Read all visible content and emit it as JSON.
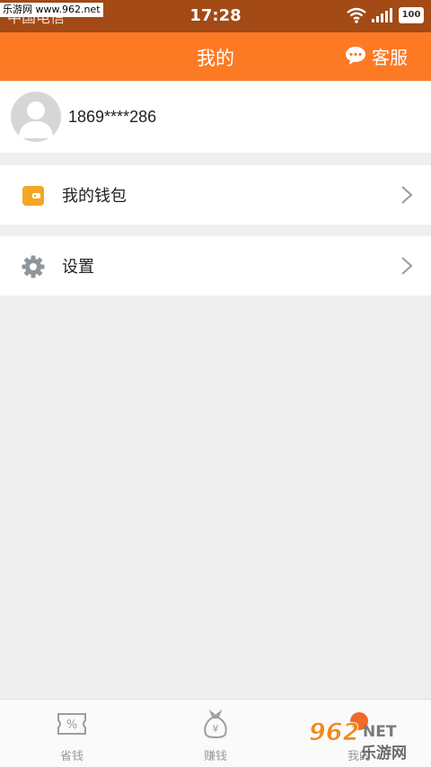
{
  "status_bar": {
    "carrier": "中国电信",
    "time": "17:28",
    "battery": "100"
  },
  "watermark": "乐游网 www.962.net",
  "header": {
    "title": "我的",
    "service_label": "客服"
  },
  "profile": {
    "phone": "1869****286"
  },
  "menu": [
    {
      "label": "我的钱包",
      "icon": "wallet-icon"
    },
    {
      "label": "设置",
      "icon": "gear-icon"
    }
  ],
  "tabs": [
    {
      "label": "省钱",
      "icon": "discount-ticket-icon"
    },
    {
      "label": "赚钱",
      "icon": "money-bag-icon"
    },
    {
      "label": "我的",
      "icon": "profile-icon"
    }
  ],
  "logo": {
    "number": "962",
    "suffix": "NET",
    "name": "乐游网"
  },
  "colors": {
    "header": "#fd7a25",
    "status_bar": "#a34a16",
    "wallet": "#f6a623",
    "background": "#efefef"
  }
}
